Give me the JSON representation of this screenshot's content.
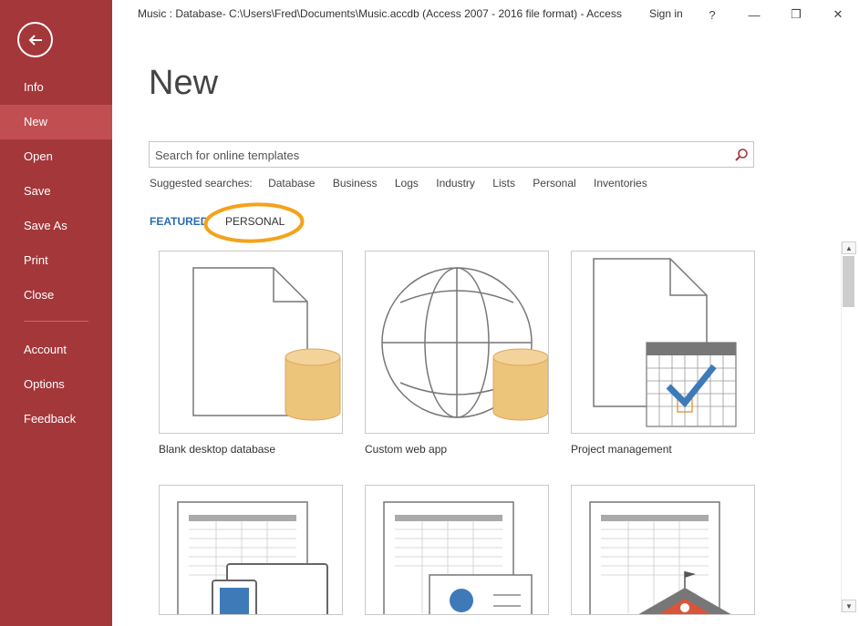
{
  "window": {
    "title": "Music : Database- C:\\Users\\Fred\\Documents\\Music.accdb (Access 2007 - 2016 file format) - Access",
    "sign_in": "Sign in",
    "help": "?",
    "minimize": "—",
    "restore": "❐",
    "close": "✕"
  },
  "sidebar": {
    "items": [
      {
        "label": "Info"
      },
      {
        "label": "New"
      },
      {
        "label": "Open"
      },
      {
        "label": "Save"
      },
      {
        "label": "Save As"
      },
      {
        "label": "Print"
      },
      {
        "label": "Close"
      },
      {
        "label": "Account"
      },
      {
        "label": "Options"
      },
      {
        "label": "Feedback"
      }
    ],
    "active": "New",
    "color": "#a4373a",
    "active_color": "#c14f52"
  },
  "main": {
    "title": "New",
    "search": {
      "placeholder": "Search for online templates",
      "value": ""
    },
    "suggested": {
      "label": "Suggested searches:",
      "links": [
        "Database",
        "Business",
        "Logs",
        "Industry",
        "Lists",
        "Personal",
        "Inventories"
      ]
    },
    "tabs": [
      {
        "label": "FEATURED",
        "selected": true
      },
      {
        "label": "PERSONAL",
        "selected": false
      }
    ],
    "highlight_color": "#f5a21b",
    "templates": [
      {
        "label": "Blank desktop database",
        "icon": "blank-database-icon"
      },
      {
        "label": "Custom web app",
        "icon": "globe-database-icon"
      },
      {
        "label": "Project management",
        "icon": "calendar-check-icon"
      },
      {
        "label": "",
        "icon": "table-device-icon"
      },
      {
        "label": "",
        "icon": "table-contact-card-icon"
      },
      {
        "label": "",
        "icon": "table-school-icon"
      }
    ]
  }
}
